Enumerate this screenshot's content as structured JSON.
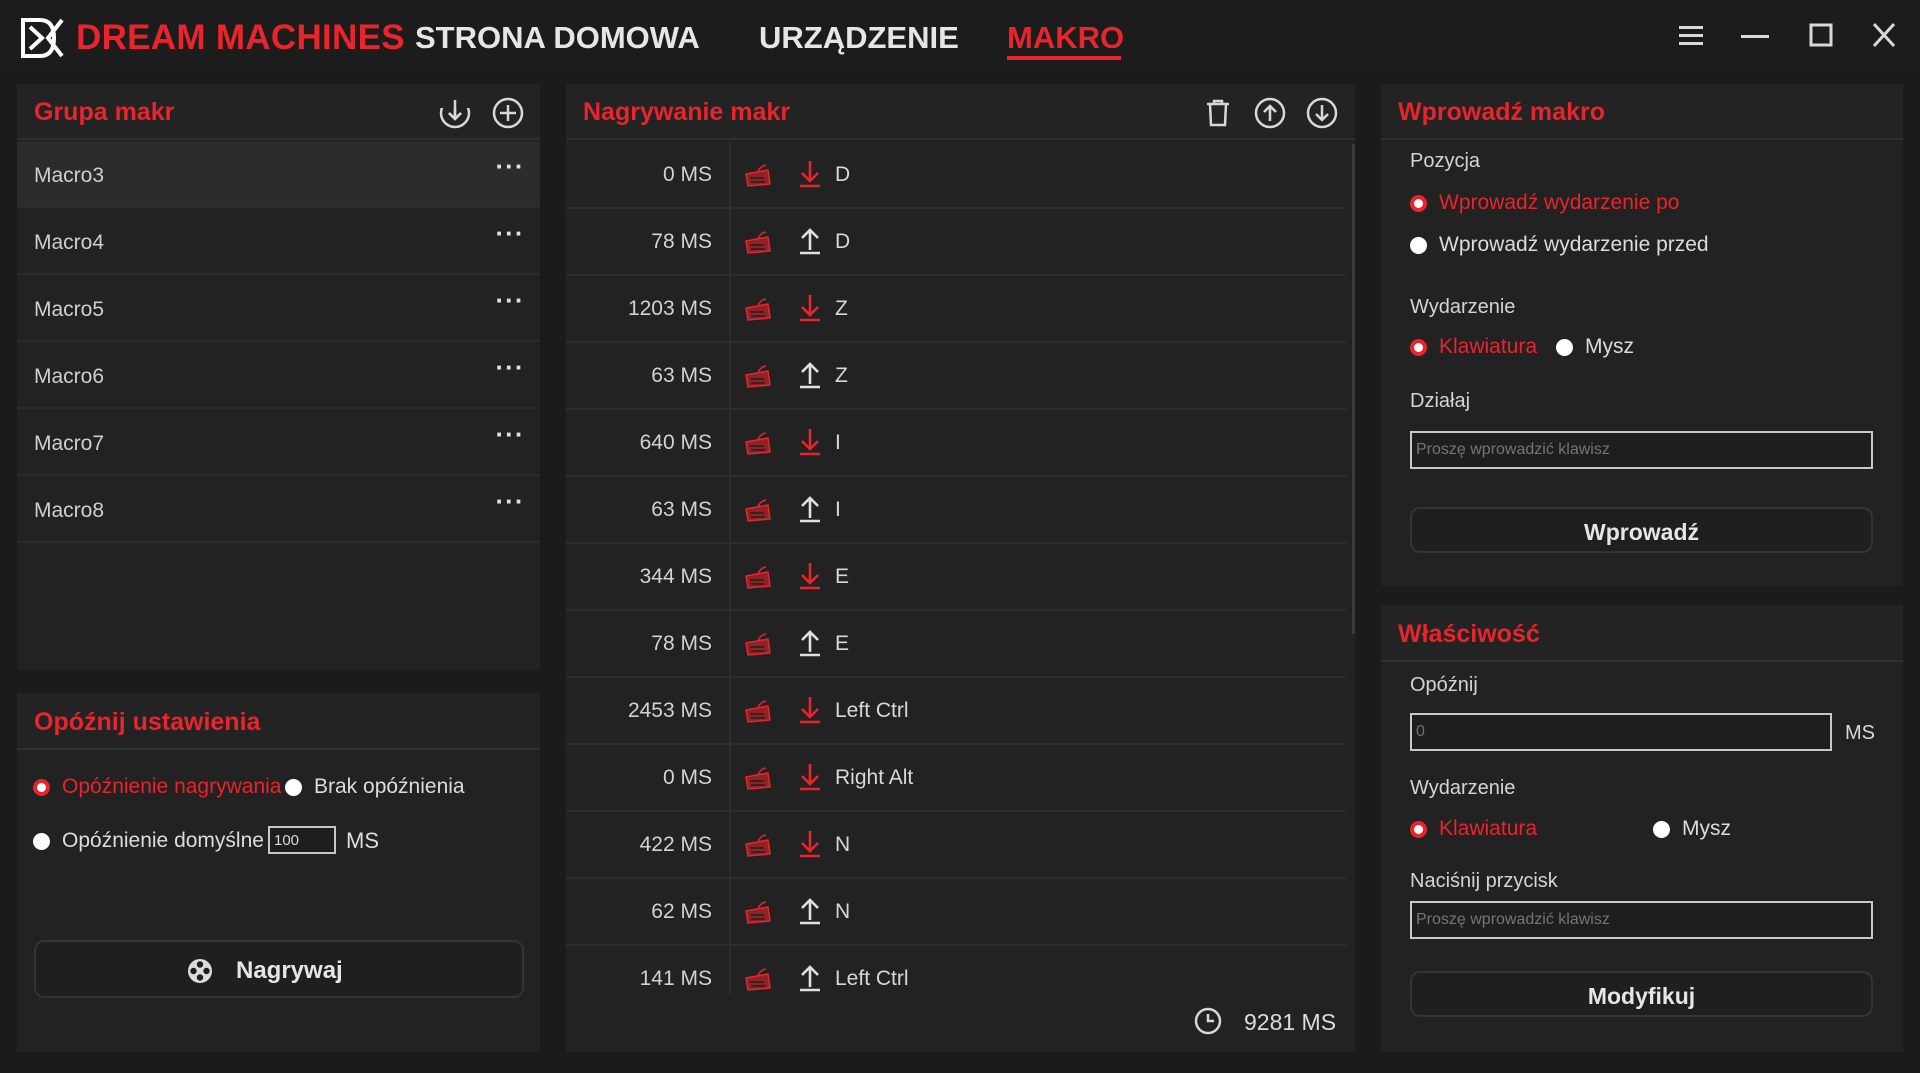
{
  "app": {
    "brand": "DREAM MACHINES",
    "tabs": [
      {
        "label": "STRONA DOMOWA",
        "active": false
      },
      {
        "label": "URZĄDZENIE",
        "active": false
      },
      {
        "label": "MAKRO",
        "active": true
      }
    ]
  },
  "colors": {
    "accent": "#e8242c",
    "panel": "#222222",
    "background": "#1b1b1b"
  },
  "macro_group": {
    "title": "Grupa makr",
    "items": [
      {
        "name": "Macro3",
        "selected": true,
        "more": "···"
      },
      {
        "name": "Macro4",
        "selected": false,
        "more": "···"
      },
      {
        "name": "Macro5",
        "selected": false,
        "more": "···"
      },
      {
        "name": "Macro6",
        "selected": false,
        "more": "···"
      },
      {
        "name": "Macro7",
        "selected": false,
        "more": "···"
      },
      {
        "name": "Macro8",
        "selected": false,
        "more": "···"
      }
    ]
  },
  "delay_settings": {
    "title": "Opóźnij ustawienia",
    "option_record": "Opóźnienie nagrywania",
    "option_none": "Brak opóźnienia",
    "option_default": "Opóźnienie domyślne",
    "default_value": "100",
    "unit": "MS",
    "selected": "record",
    "record_button": "Nagrywaj"
  },
  "recording": {
    "title": "Nagrywanie makr",
    "events": [
      {
        "time": "0 MS",
        "direction": "down",
        "key": "D"
      },
      {
        "time": "78 MS",
        "direction": "up",
        "key": "D"
      },
      {
        "time": "1203 MS",
        "direction": "down",
        "key": "Z"
      },
      {
        "time": "63 MS",
        "direction": "up",
        "key": "Z"
      },
      {
        "time": "640 MS",
        "direction": "down",
        "key": "I"
      },
      {
        "time": "63 MS",
        "direction": "up",
        "key": "I"
      },
      {
        "time": "344 MS",
        "direction": "down",
        "key": "E"
      },
      {
        "time": "78 MS",
        "direction": "up",
        "key": "E"
      },
      {
        "time": "2453 MS",
        "direction": "down",
        "key": "Left Ctrl"
      },
      {
        "time": "0 MS",
        "direction": "down",
        "key": "Right Alt"
      },
      {
        "time": "422 MS",
        "direction": "down",
        "key": "N"
      },
      {
        "time": "62 MS",
        "direction": "up",
        "key": "N"
      },
      {
        "time": "141 MS",
        "direction": "up",
        "key": "Left Ctrl"
      }
    ],
    "total": "9281 MS"
  },
  "insert_macro": {
    "title": "Wprowadź makro",
    "position_label": "Pozycja",
    "position_after": "Wprowadź wydarzenie po",
    "position_before": "Wprowadź wydarzenie przed",
    "event_label": "Wydarzenie",
    "event_keyboard": "Klawiatura",
    "event_mouse": "Mysz",
    "action_label": "Działaj",
    "action_placeholder": "Proszę wprowadzić klawisz",
    "submit": "Wprowadź"
  },
  "property": {
    "title": "Właściwość",
    "delay_label": "Opóźnij",
    "delay_value": "0",
    "delay_unit": "MS",
    "event_label": "Wydarzenie",
    "event_keyboard": "Klawiatura",
    "event_mouse": "Mysz",
    "key_label": "Naciśnij przycisk",
    "key_placeholder": "Proszę wprowadzić klawisz",
    "submit": "Modyfikuj"
  }
}
